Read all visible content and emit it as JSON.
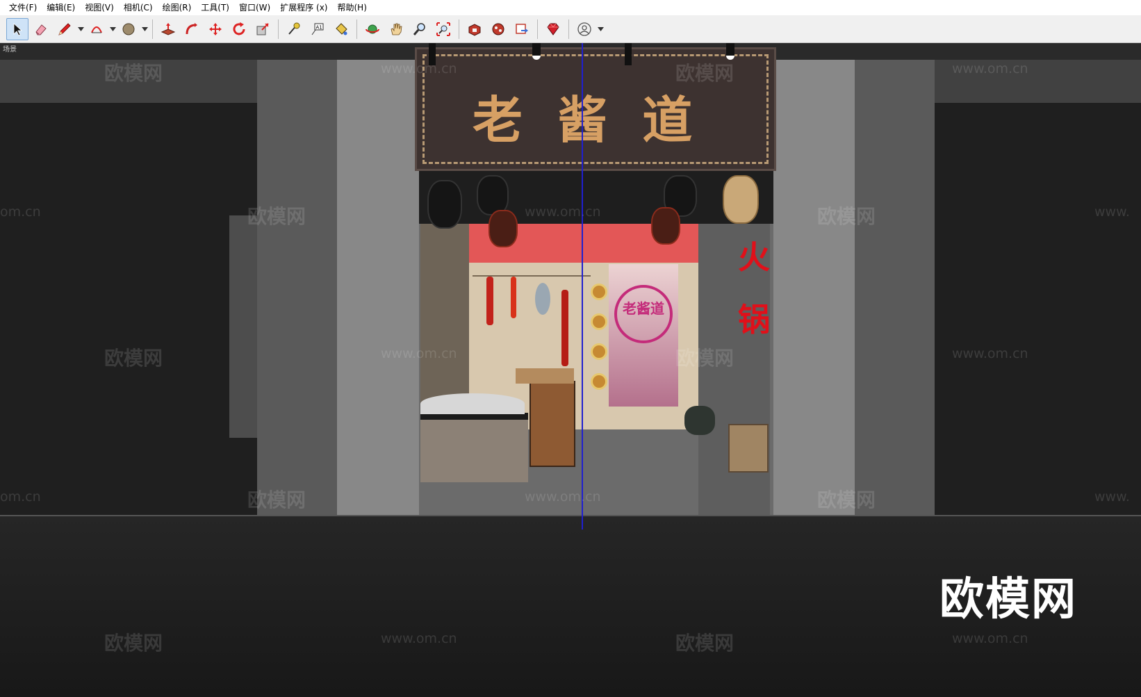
{
  "menu": {
    "items": [
      {
        "label": "文件(F)"
      },
      {
        "label": "编辑(E)"
      },
      {
        "label": "视图(V)"
      },
      {
        "label": "相机(C)"
      },
      {
        "label": "绘图(R)"
      },
      {
        "label": "工具(T)"
      },
      {
        "label": "窗口(W)"
      },
      {
        "label": "扩展程序 (x)"
      },
      {
        "label": "帮助(H)"
      }
    ]
  },
  "toolbar": {
    "tools": [
      {
        "icon": "select-arrow-icon",
        "active": true
      },
      {
        "icon": "eraser-icon"
      },
      {
        "icon": "pencil-line-icon",
        "dropdown": true
      },
      {
        "icon": "arc-icon",
        "dropdown": true
      },
      {
        "icon": "circle-shape-icon",
        "dropdown": true
      },
      {
        "icon": "push-pull-icon"
      },
      {
        "icon": "follow-me-icon"
      },
      {
        "icon": "move-icon"
      },
      {
        "icon": "rotate-icon"
      },
      {
        "icon": "scale-icon"
      },
      {
        "icon": "tape-measure-icon"
      },
      {
        "icon": "text-label-icon"
      },
      {
        "icon": "paint-bucket-icon"
      },
      {
        "icon": "orbit-icon"
      },
      {
        "icon": "pan-hand-icon"
      },
      {
        "icon": "zoom-icon"
      },
      {
        "icon": "zoom-extents-icon"
      },
      {
        "icon": "warehouse-icon"
      },
      {
        "icon": "extension-warehouse-icon"
      },
      {
        "icon": "send-to-layout-icon"
      },
      {
        "icon": "ruby-console-icon"
      },
      {
        "icon": "user-account-icon",
        "dropdown": true
      }
    ]
  },
  "viewport": {
    "scene_label": "场景",
    "sign_text": "老  酱  道",
    "banner_chars": [
      "火",
      "锅"
    ],
    "curtain_text": "老酱道",
    "watermark_text": "欧模网",
    "watermark_url": "www.om.cn",
    "watermark_partial_url": "om.cn",
    "watermark_partial_url_right": "www.",
    "corner_logo": "欧模网"
  },
  "colors": {
    "accent": "#7aa7d6",
    "sign_text": "#d7a064",
    "banner_red": "#e0101a",
    "axis_blue": "#1f1fd0"
  }
}
